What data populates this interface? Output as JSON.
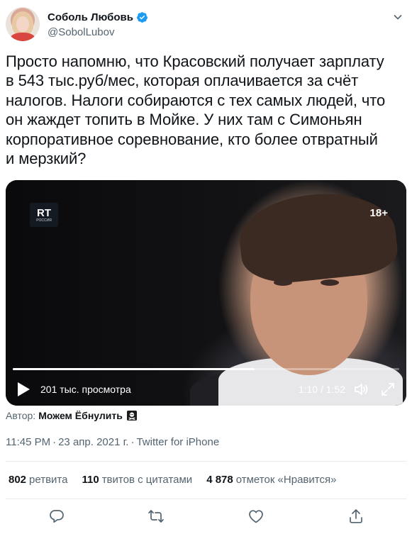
{
  "author": {
    "name": "Соболь Любовь",
    "handle": "@SobolLubov"
  },
  "icons": {
    "verified": "verified-badge-icon",
    "caret": "chevron-down-icon",
    "play": "play-icon",
    "volume": "volume-icon",
    "fullscreen": "fullscreen-icon",
    "reply": "reply-icon",
    "retweet": "retweet-icon",
    "like": "heart-icon",
    "share": "share-icon",
    "pirate": "skull-crossbones-icon"
  },
  "tweet": {
    "text": "Просто напомню, что Красовский получает зарплату\nв 543 тыс.руб/мес, которая оплачивается за счёт\nналогов. Налоги собираются с тех самых людей, что\nон жаждет топить в Мойке. У них там с Симоньян\nкорпоративное соревнование, кто более отвратный\nи мерзкий?"
  },
  "video": {
    "channel_logo": "RT",
    "channel_sub": "РОССИЯ",
    "age_rating": "18+",
    "views": "201 тыс. просмотра",
    "timecode": "1:10 / 1:52",
    "progress": 0.625
  },
  "attribution": {
    "label": "Автор:",
    "author": "Можем Ёбнулить"
  },
  "meta": {
    "time": "11:45 PM",
    "date": "23 апр. 2021 г.",
    "source": "Twitter for iPhone",
    "separator": "·"
  },
  "stats": {
    "retweets_count": "802",
    "retweets_label": "ретвита",
    "quotes_count": "110",
    "quotes_label": "твитов с цитатами",
    "likes_count": "4 878",
    "likes_label": "отметок «Нравится»"
  },
  "colors": {
    "text": "#0f1419",
    "secondary": "#536471",
    "verified": "#1d9bf0",
    "divider": "#e6ecf0"
  }
}
